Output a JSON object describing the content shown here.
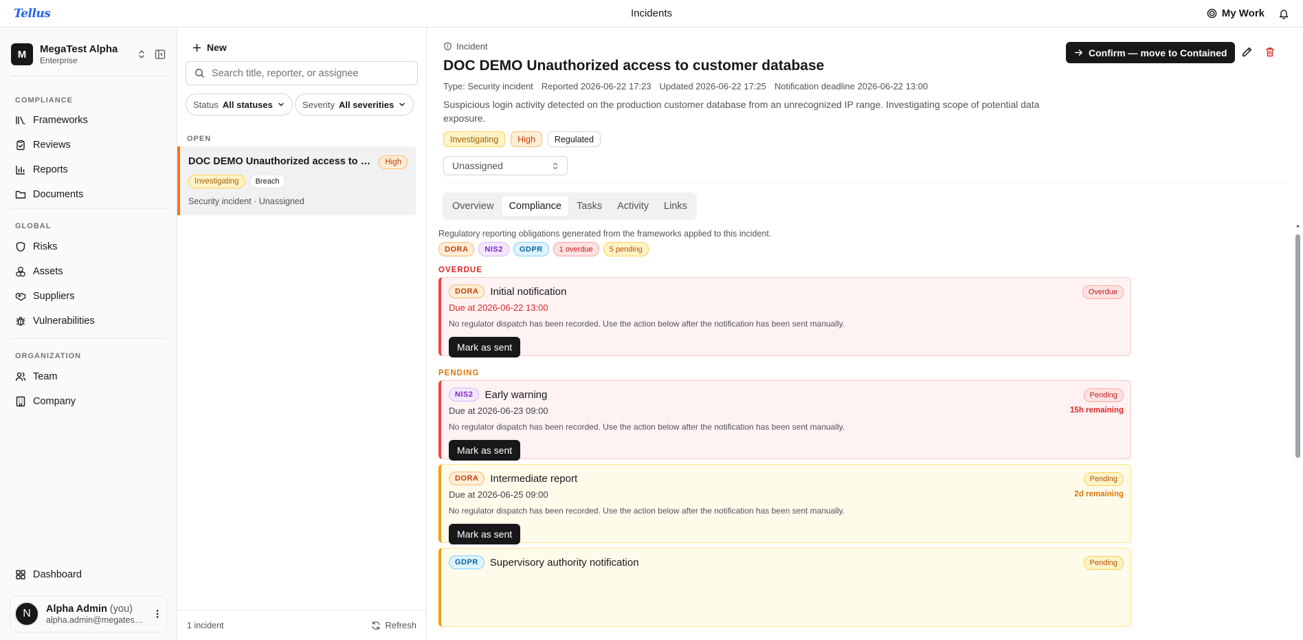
{
  "app": {
    "logo": "Tellus",
    "title": "Incidents",
    "my_work": "My Work"
  },
  "org": {
    "initial": "M",
    "name": "MegaTest Alpha",
    "plan": "Enterprise"
  },
  "sidebar": {
    "compliance_label": "COMPLIANCE",
    "compliance": [
      {
        "label": "Frameworks",
        "icon": "frameworks-icon"
      },
      {
        "label": "Reviews",
        "icon": "clipboard-check-icon"
      },
      {
        "label": "Reports",
        "icon": "bar-chart-icon"
      },
      {
        "label": "Documents",
        "icon": "folder-icon"
      }
    ],
    "global_label": "GLOBAL",
    "global": [
      {
        "label": "Risks",
        "icon": "shield-icon"
      },
      {
        "label": "Assets",
        "icon": "boxes-icon"
      },
      {
        "label": "Suppliers",
        "icon": "handshake-icon"
      },
      {
        "label": "Vulnerabilities",
        "icon": "bug-icon"
      }
    ],
    "organization_label": "ORGANIZATION",
    "organization": [
      {
        "label": "Team",
        "icon": "users-icon"
      },
      {
        "label": "Company",
        "icon": "building-icon"
      }
    ],
    "dashboard": "Dashboard"
  },
  "user": {
    "initial": "N",
    "name": "Alpha Admin",
    "you": "(you)",
    "email": "alpha.admin@megatest..."
  },
  "list": {
    "new_label": "New",
    "search_placeholder": "Search title, reporter, or assignee",
    "filter_status_label": "Status",
    "filter_status_value": "All statuses",
    "filter_severity_label": "Severity",
    "filter_severity_value": "All severities",
    "open_label": "OPEN",
    "item": {
      "title": "DOC DEMO Unauthorized access to customer database",
      "severity": "High",
      "status": "Investigating",
      "category": "Breach",
      "meta": "Security incident · Unassigned"
    },
    "count": "1 incident",
    "refresh": "Refresh"
  },
  "detail": {
    "crumb": "Incident",
    "title": "DOC DEMO Unauthorized access to customer database",
    "meta": {
      "type": "Type: Security incident",
      "reported": "Reported 2026-06-22 17:23",
      "updated": "Updated 2026-06-22 17:25",
      "deadline": "Notification deadline 2026-06-22 13:00"
    },
    "description": "Suspicious login activity detected on the production customer database from an unrecognized IP range. Investigating scope of potential data exposure.",
    "badges": {
      "status": "Investigating",
      "severity": "High",
      "regulated": "Regulated"
    },
    "assignee": "Unassigned",
    "confirm_btn": "Confirm — move to Contained",
    "tabs": [
      "Overview",
      "Compliance",
      "Tasks",
      "Activity",
      "Links"
    ],
    "active_tab": "Compliance"
  },
  "compliance": {
    "intro": "Regulatory reporting obligations generated from the frameworks applied to this incident.",
    "chips": {
      "dora": "DORA",
      "nis2": "NIS2",
      "gdpr": "GDPR",
      "overdue": "1 overdue",
      "pending": "5 pending"
    },
    "overdue_label": "OVERDUE",
    "pending_label": "PENDING",
    "note": "No regulator dispatch has been recorded. Use the action below after the notification has been sent manually.",
    "mark_btn": "Mark as sent",
    "obligations": [
      {
        "framework": "DORA",
        "name": "Initial notification",
        "due": "Due at 2026-06-22 13:00",
        "status": "Overdue",
        "remaining": ""
      },
      {
        "framework": "NIS2",
        "name": "Early warning",
        "due": "Due at 2026-06-23 09:00",
        "status": "Pending",
        "remaining": "15h remaining"
      },
      {
        "framework": "DORA",
        "name": "Intermediate report",
        "due": "Due at 2026-06-25 09:00",
        "status": "Pending",
        "remaining": "2d remaining"
      },
      {
        "framework": "GDPR",
        "name": "Supervisory authority notification",
        "due": "",
        "status": "Pending",
        "remaining": ""
      }
    ]
  },
  "colors": {
    "accent": "#2563eb",
    "danger": "#dc2626",
    "warning": "#d97706",
    "dark": "#18181b"
  }
}
